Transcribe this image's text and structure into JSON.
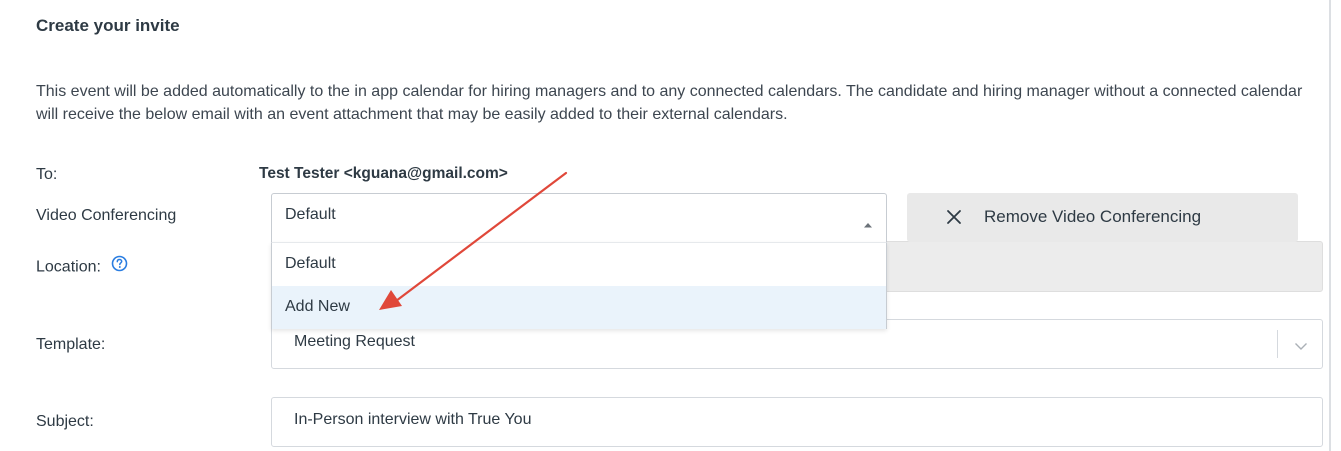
{
  "header": {
    "title": "Create your invite",
    "description": "This event will be added automatically to the in app calendar for hiring managers and to any connected calendars. The candidate and hiring manager without a connected calendar will receive the below email with an event attachment that may be easily added to their external calendars."
  },
  "form": {
    "to": {
      "label": "To:",
      "value": "Test Tester <kguana@gmail.com>"
    },
    "video_conferencing": {
      "label": "Video Conferencing",
      "selected": "Default",
      "options": [
        "Default",
        "Add New"
      ],
      "hovered_option": "Add New",
      "remove_button_label": "Remove Video Conferencing"
    },
    "location": {
      "label": "Location:",
      "value": ""
    },
    "template": {
      "label": "Template:",
      "value": "Meeting Request"
    },
    "subject": {
      "label": "Subject:",
      "value": "In-Person interview with True You"
    }
  },
  "icons": {
    "help": "question-circle-icon",
    "close": "close-icon",
    "caret": "caret-up-icon",
    "chevron": "chevron-down-icon"
  },
  "colors": {
    "annotation_arrow": "#e0483a",
    "help_icon": "#2a7de1",
    "hover_option_bg": "#eaf3fb",
    "disabled_bg": "#ececec"
  }
}
